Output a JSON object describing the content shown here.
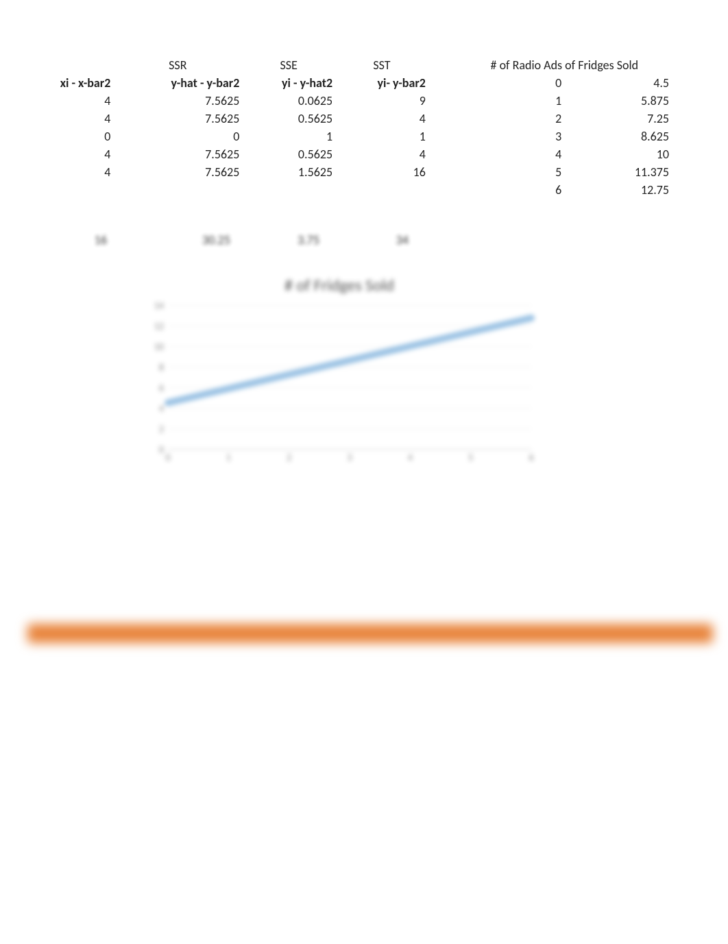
{
  "table": {
    "headers_row1": {
      "ssr": "SSR",
      "sse": "SSE",
      "sst": "SST",
      "radio_ads": "# of Radio Ad",
      "fridges_sold_hdr": "# of Fridges Sold",
      "radio_ads_overlap": "# of Radio Ads   of Fridges Sold"
    },
    "headers_row2": {
      "xi": "xi - x-bar2",
      "yhat": "y-hat - y-bar2",
      "yi_yhat": "yi - y-hat2",
      "yi_ybar": "yi- y-bar2"
    },
    "rows": [
      {
        "xi": "4",
        "yhat": "7.5625",
        "yi_yhat": "0.0625",
        "yi_ybar": "9",
        "radio": "0",
        "fridges": "4.5"
      },
      {
        "xi": "4",
        "yhat": "7.5625",
        "yi_yhat": "0.5625",
        "yi_ybar": "4",
        "radio": "1",
        "fridges": "5.875"
      },
      {
        "xi": "0",
        "yhat": "0",
        "yi_yhat": "1",
        "yi_ybar": "1",
        "radio": "2",
        "fridges": "7.25"
      },
      {
        "xi": "4",
        "yhat": "7.5625",
        "yi_yhat": "0.5625",
        "yi_ybar": "4",
        "radio": "3",
        "fridges": "8.625"
      },
      {
        "xi": "4",
        "yhat": "7.5625",
        "yi_yhat": "1.5625",
        "yi_ybar": "16",
        "radio": "4",
        "fridges": "10"
      },
      {
        "xi": "",
        "yhat": "",
        "yi_yhat": "",
        "yi_ybar": "",
        "radio": "5",
        "fridges": "11.375"
      },
      {
        "xi": "",
        "yhat": "",
        "yi_yhat": "",
        "yi_ybar": "",
        "radio": "6",
        "fridges": "12.75"
      }
    ],
    "totals": {
      "xi": "16",
      "yhat": "30.25",
      "yi_yhat": "3.75",
      "yi_ybar": "34"
    }
  },
  "chart_data": {
    "type": "line",
    "title": "# of Fridges Sold",
    "xlabel": "",
    "ylabel": "",
    "x": [
      0,
      1,
      2,
      3,
      4,
      5,
      6
    ],
    "values": [
      4.5,
      5.875,
      7.25,
      8.625,
      10,
      11.375,
      12.75
    ],
    "x_ticks": [
      "0",
      "1",
      "2",
      "3",
      "4",
      "5",
      "6"
    ],
    "y_ticks": [
      "0",
      "2",
      "4",
      "6",
      "8",
      "10",
      "12",
      "14"
    ],
    "xlim": [
      0,
      6
    ],
    "ylim": [
      0,
      14
    ],
    "line_color": "#9cc3e4",
    "line_width": 8
  },
  "colors": {
    "accent_orange": "#e8833a",
    "chart_line": "#9cc3e4"
  }
}
